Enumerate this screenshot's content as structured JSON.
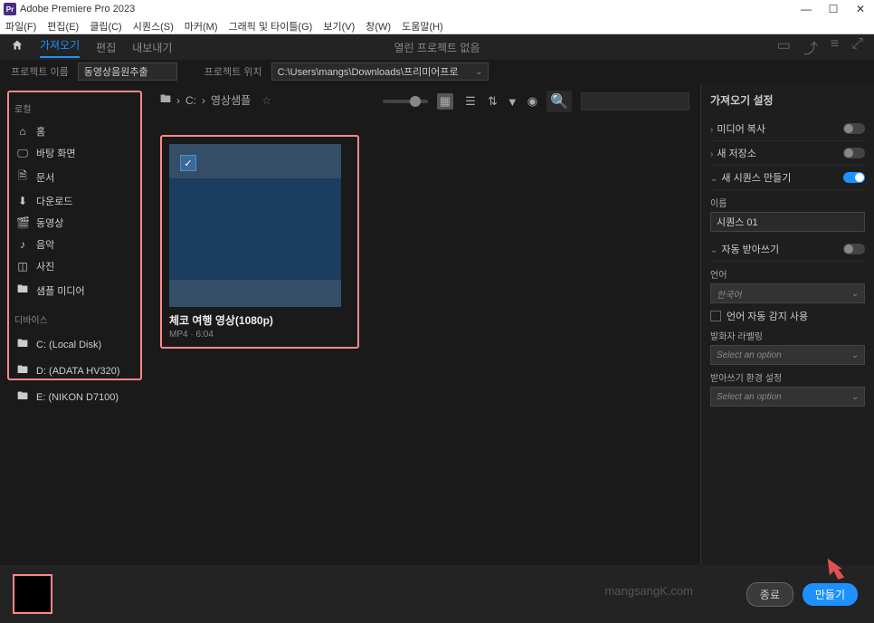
{
  "app_title": "Adobe Premiere Pro 2023",
  "menus": [
    "파일(F)",
    "편집(E)",
    "클립(C)",
    "시퀀스(S)",
    "마커(M)",
    "그래픽 및 타이틀(G)",
    "보기(V)",
    "창(W)",
    "도움말(H)"
  ],
  "topnav": {
    "tabs": [
      "가져오기",
      "편집",
      "내보내기"
    ],
    "status": "열린 프로젝트 없음"
  },
  "project": {
    "name_label": "프로젝트 이름",
    "name_value": "동영상음원추출",
    "loc_label": "프로젝트 위치",
    "loc_value": "C:\\Users\\mangs\\Downloads\\프리미어프로"
  },
  "sidebar": {
    "cat_local": "로컬",
    "items": [
      {
        "icon": "home",
        "label": "홈"
      },
      {
        "icon": "desktop",
        "label": "바탕 화면"
      },
      {
        "icon": "doc",
        "label": "문서"
      },
      {
        "icon": "download",
        "label": "다운로드"
      },
      {
        "icon": "video",
        "label": "동영상"
      },
      {
        "icon": "music",
        "label": "음악"
      },
      {
        "icon": "photo",
        "label": "사진"
      },
      {
        "icon": "folder",
        "label": "샘플 미디어"
      }
    ],
    "cat_device": "디바이스",
    "devices": [
      {
        "label": "C: (Local Disk)"
      },
      {
        "label": "D: (ADATA HV320)"
      },
      {
        "label": "E: (NIKON D7100)"
      }
    ]
  },
  "breadcrumb": {
    "drive": "C:",
    "folder": "영상샘플"
  },
  "card": {
    "title": "체코 여행 영상(1080p)",
    "meta": "MP4 · 6:04"
  },
  "right": {
    "title": "가져오기 설정",
    "copy": "미디어 복사",
    "newloc": "새 저장소",
    "newseq": "새 시퀀스 만들기",
    "name_label": "이름",
    "name_value": "시퀀스 01",
    "autotrans": "자동 받아쓰기",
    "lang_label": "언어",
    "lang_value": "한국어",
    "autodetect": "언어 자동 감지 사용",
    "speaker": "발화자 라벨링",
    "speaker_opt": "Select an option",
    "env": "받아쓰기 환경 설정",
    "env_opt": "Select an option"
  },
  "footer": {
    "watermark": "mangsangK.com",
    "close": "종료",
    "create": "만들기"
  }
}
